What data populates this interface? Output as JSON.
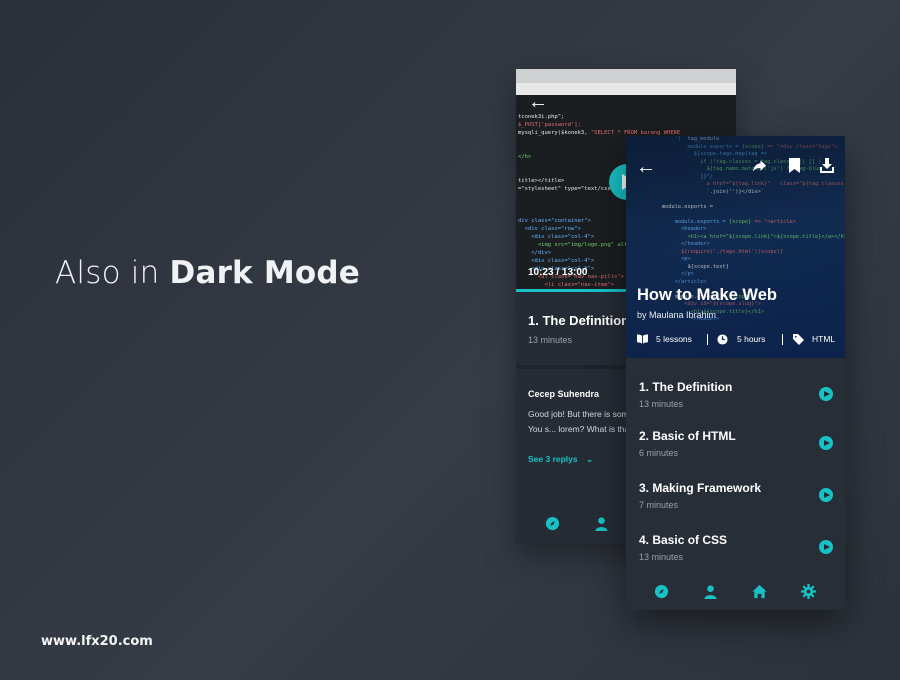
{
  "headline": {
    "light": "Also in ",
    "bold": "Dark Mode"
  },
  "site": "www.lfx20.com",
  "colors": {
    "accent": "#18c1c6",
    "background": "#2f343d",
    "card": "#282e37"
  },
  "back_screen": {
    "video_time": "10:23 / 13:00",
    "video_progress": 0.8,
    "lesson_title": "1. The Definition",
    "lesson_duration": "13 minutes",
    "comment_author": "Cecep Suhendra",
    "comment_text": "Good job! But there is something still confused with it. You s... lorem? What is that mean",
    "see_replies": "See 3 replys",
    "nav_icons": [
      "compass-icon",
      "user-icon"
    ]
  },
  "front_screen": {
    "course_title": "How to Make Web",
    "author": "by Maulana Ibrahim",
    "lessons_count": "5 lessons",
    "duration": "5 hours",
    "tag": "HTML",
    "lessons": [
      {
        "title": "1. The Definition",
        "duration": "13 minutes"
      },
      {
        "title": "2. Basic of HTML",
        "duration": "6 minutes"
      },
      {
        "title": "3. Making Framework",
        "duration": "7 minutes"
      },
      {
        "title": "4. Basic of CSS",
        "duration": "13 minutes"
      }
    ],
    "nav_icons": [
      "compass-icon",
      "user-icon",
      "home-icon",
      "gear-icon"
    ]
  }
}
